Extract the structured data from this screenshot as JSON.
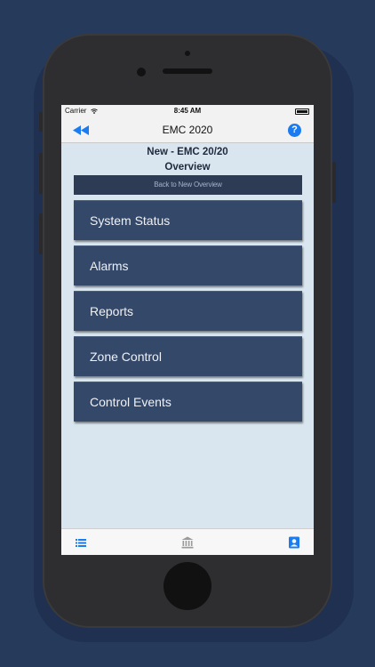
{
  "colors": {
    "background": "#263a5c",
    "accent": "#1a7cf0",
    "button": "#34486a",
    "screen": "#d9e6f0"
  },
  "status_bar": {
    "carrier": "Carrier",
    "time": "8:45 AM"
  },
  "nav": {
    "title": "EMC 2020",
    "back_icon": "rewind-icon",
    "help_icon": "help-icon",
    "help_glyph": "?"
  },
  "page": {
    "title_line1": "New - EMC 20/20",
    "title_line2": "Overview",
    "back_link": "Back to New Overview"
  },
  "menu": {
    "items": [
      {
        "label": "System Status"
      },
      {
        "label": "Alarms"
      },
      {
        "label": "Reports"
      },
      {
        "label": "Zone Control"
      },
      {
        "label": "Control Events"
      }
    ]
  },
  "tab_bar": {
    "icons": [
      "list-icon",
      "bank-icon",
      "contact-icon"
    ]
  }
}
